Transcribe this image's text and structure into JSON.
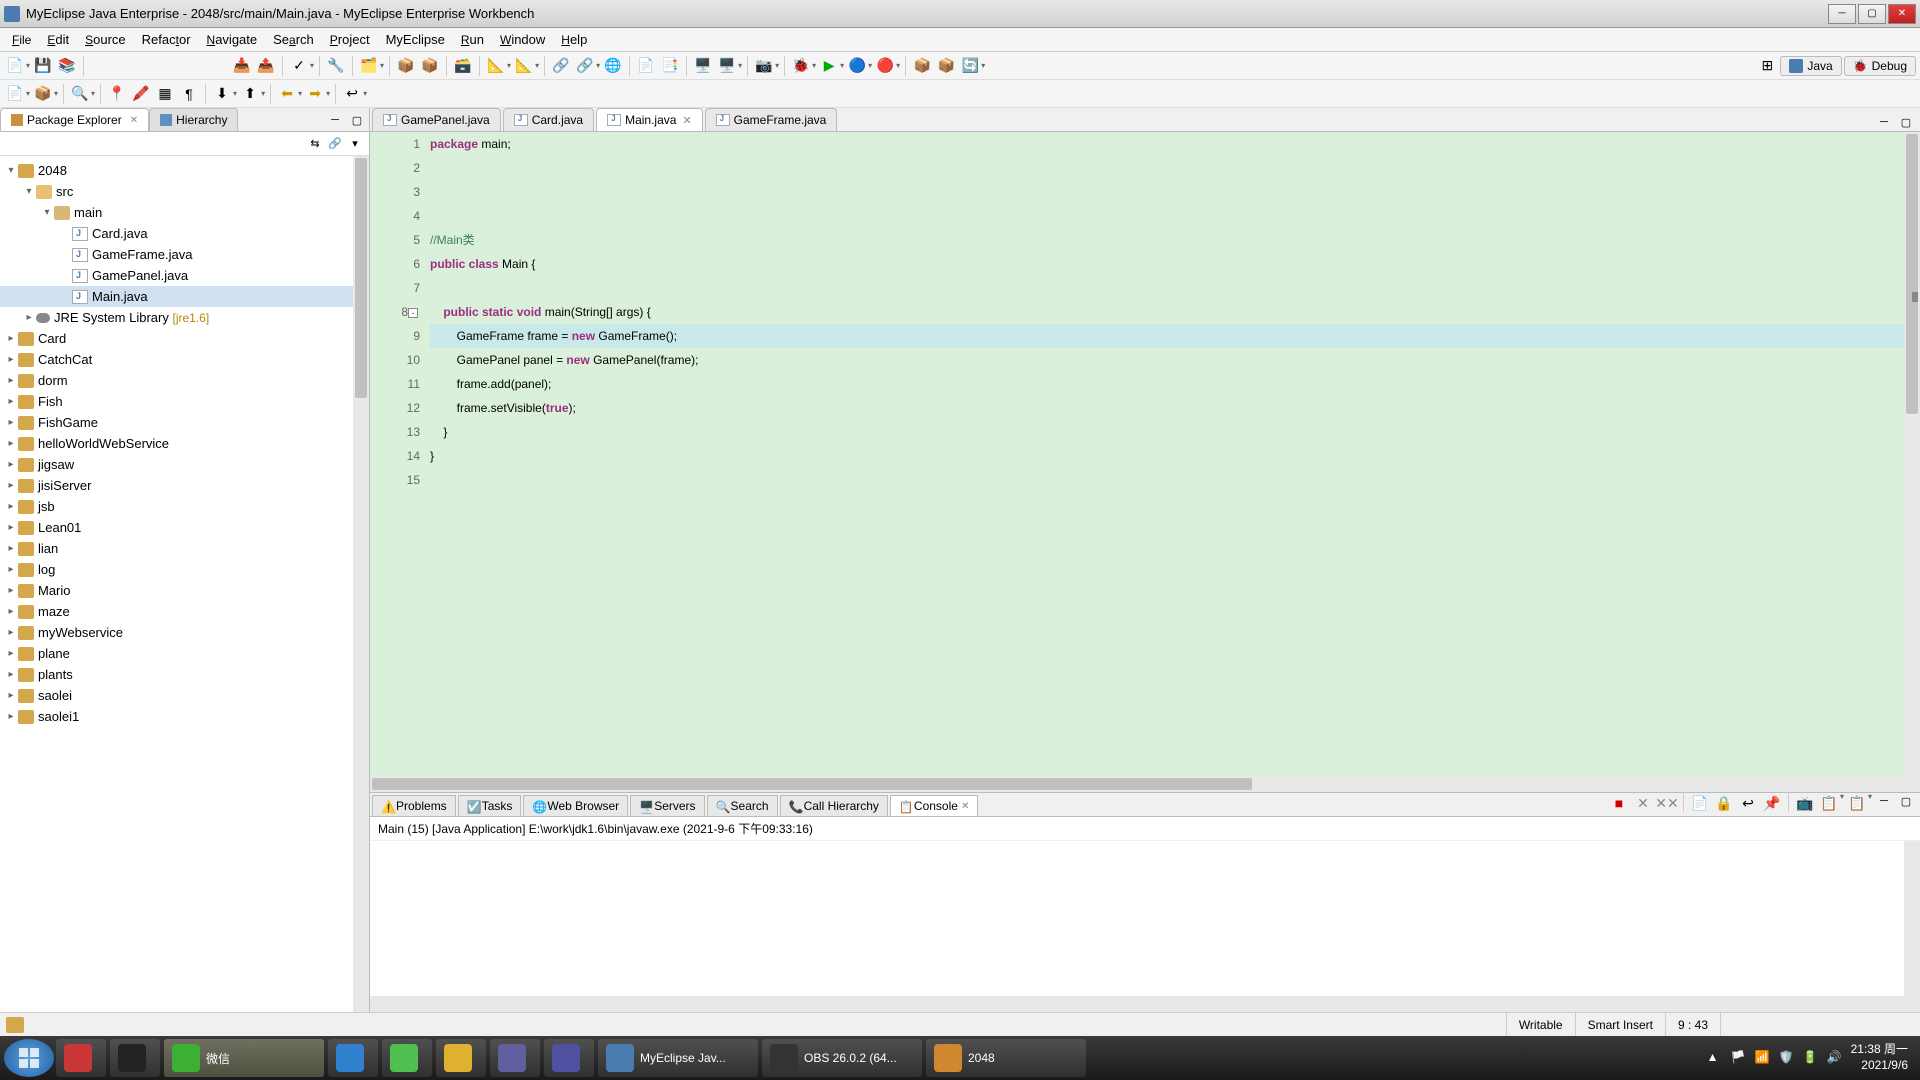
{
  "window": {
    "title": "MyEclipse Java Enterprise - 2048/src/main/Main.java - MyEclipse Enterprise Workbench"
  },
  "menu": {
    "file": "File",
    "edit": "Edit",
    "source": "Source",
    "refactor": "Refactor",
    "navigate": "Navigate",
    "search": "Search",
    "project": "Project",
    "myeclipse": "MyEclipse",
    "run": "Run",
    "window": "Window",
    "help": "Help"
  },
  "perspective": {
    "java": "Java",
    "debug": "Debug"
  },
  "package_explorer": {
    "tab_label": "Package Explorer",
    "hierarchy_tab": "Hierarchy",
    "root_project": "2048",
    "src": "src",
    "pkg": "main",
    "files": [
      "Card.java",
      "GameFrame.java",
      "GamePanel.java",
      "Main.java"
    ],
    "jre_lib": "JRE System Library",
    "jre_version": "[jre1.6]",
    "projects": [
      "Card",
      "CatchCat",
      "dorm",
      "Fish",
      "FishGame",
      "helloWorldWebService",
      "jigsaw",
      "jisiServer",
      "jsb",
      "Lean01",
      "lian",
      "log",
      "Mario",
      "maze",
      "myWebservice",
      "plane",
      "plants",
      "saolei",
      "saolei1"
    ]
  },
  "editor": {
    "tabs": [
      "GamePanel.java",
      "Card.java",
      "Main.java",
      "GameFrame.java"
    ],
    "active_tab_index": 2,
    "lines": [
      {
        "n": 1,
        "segs": [
          {
            "t": "package",
            "c": "kw"
          },
          {
            "t": " main;"
          }
        ]
      },
      {
        "n": 2,
        "segs": []
      },
      {
        "n": 3,
        "segs": []
      },
      {
        "n": 4,
        "segs": []
      },
      {
        "n": 5,
        "segs": [
          {
            "t": "//Main类",
            "c": "cm"
          }
        ]
      },
      {
        "n": 6,
        "segs": [
          {
            "t": "public class",
            "c": "kw"
          },
          {
            "t": " Main {"
          }
        ]
      },
      {
        "n": 7,
        "segs": []
      },
      {
        "n": 8,
        "segs": [
          {
            "t": "    "
          },
          {
            "t": "public static void",
            "c": "kw"
          },
          {
            "t": " main(String[] args) {"
          }
        ],
        "fold": true
      },
      {
        "n": 9,
        "segs": [
          {
            "t": "        GameFrame frame = "
          },
          {
            "t": "new",
            "c": "kw"
          },
          {
            "t": " GameFrame();"
          }
        ],
        "current": true
      },
      {
        "n": 10,
        "segs": [
          {
            "t": "        GamePanel panel = "
          },
          {
            "t": "new",
            "c": "kw"
          },
          {
            "t": " GamePanel(frame);"
          }
        ]
      },
      {
        "n": 11,
        "segs": [
          {
            "t": "        frame.add(panel);"
          }
        ]
      },
      {
        "n": 12,
        "segs": [
          {
            "t": "        frame.setVisible("
          },
          {
            "t": "true",
            "c": "kw"
          },
          {
            "t": ");"
          }
        ]
      },
      {
        "n": 13,
        "segs": [
          {
            "t": "    }"
          }
        ]
      },
      {
        "n": 14,
        "segs": [
          {
            "t": "}"
          }
        ]
      },
      {
        "n": 15,
        "segs": []
      }
    ]
  },
  "bottom": {
    "tabs": [
      "Problems",
      "Tasks",
      "Web Browser",
      "Servers",
      "Search",
      "Call Hierarchy",
      "Console"
    ],
    "active_index": 6,
    "console_desc": "Main (15) [Java Application] E:\\work\\jdk1.6\\bin\\javaw.exe (2021-9-6 下午09:33:16)"
  },
  "status": {
    "writable": "Writable",
    "insert": "Smart Insert",
    "position": "9 : 43"
  },
  "taskbar": {
    "items": [
      {
        "label": "",
        "color": "#c83838"
      },
      {
        "label": "",
        "color": "#222"
      },
      {
        "label": "微信",
        "color": "#3cb034",
        "active": true,
        "wide": true
      },
      {
        "label": "",
        "color": "#3080d0"
      },
      {
        "label": "",
        "color": "#50c050"
      },
      {
        "label": "",
        "color": "#e0b030"
      },
      {
        "label": "",
        "color": "#6060a0"
      },
      {
        "label": "",
        "color": "#5050a0"
      },
      {
        "label": "MyEclipse Jav...",
        "color": "#4a7cb0",
        "wide": true
      },
      {
        "label": "OBS 26.0.2 (64...",
        "color": "#333",
        "wide": true
      },
      {
        "label": "2048",
        "color": "#d08830",
        "wide": true
      }
    ],
    "clock_time": "21:38 周一",
    "clock_date": "2021/9/6"
  }
}
